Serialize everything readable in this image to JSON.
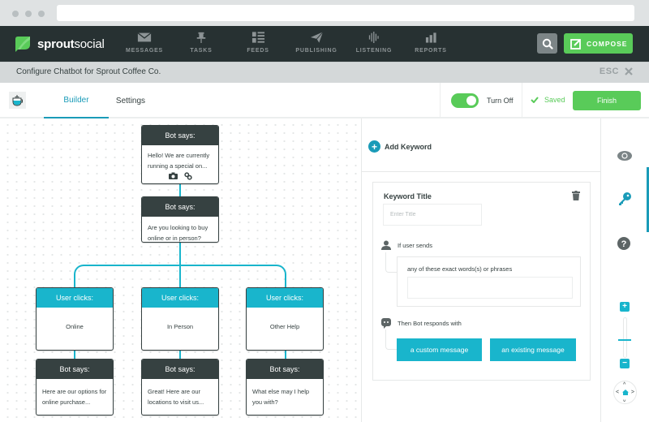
{
  "browser": {
    "address": ""
  },
  "brand": {
    "name_bold": "sprout",
    "name_light": "social"
  },
  "nav": {
    "items": [
      {
        "label": "MESSAGES",
        "icon": "envelope-icon"
      },
      {
        "label": "TASKS",
        "icon": "pushpin-icon"
      },
      {
        "label": "FEEDS",
        "icon": "feed-list-icon"
      },
      {
        "label": "PUBLISHING",
        "icon": "paper-plane-icon"
      },
      {
        "label": "LISTENING",
        "icon": "soundwave-icon"
      },
      {
        "label": "REPORTS",
        "icon": "bar-chart-icon"
      }
    ],
    "search_icon": "search-icon",
    "compose_label": "COMPOSE"
  },
  "subheader": {
    "title": "Configure Chatbot for Sprout Coffee Co.",
    "esc_label": "ESC"
  },
  "toolbar": {
    "tabs": [
      {
        "label": "Builder",
        "active": true
      },
      {
        "label": "Settings",
        "active": false
      }
    ],
    "toggle_on": true,
    "toggle_label": "Turn Off",
    "saved_label": "Saved",
    "finish_label": "Finish"
  },
  "flow": {
    "nodes": [
      {
        "type": "bot",
        "header": "Bot says:",
        "text": "Hello! We are currently running a special on...",
        "attachments": [
          "camera-icon",
          "link-icon"
        ]
      },
      {
        "type": "bot",
        "header": "Bot says:",
        "text": "Are you looking to buy online or in person?"
      },
      {
        "type": "user",
        "header": "User clicks:",
        "text": "Online"
      },
      {
        "type": "user",
        "header": "User clicks:",
        "text": "In Person"
      },
      {
        "type": "user",
        "header": "User clicks:",
        "text": "Other Help"
      },
      {
        "type": "bot",
        "header": "Bot says:",
        "text": "Here are our options for online purchase..."
      },
      {
        "type": "bot",
        "header": "Bot says:",
        "text": "Great! Here are our locations to visit us..."
      },
      {
        "type": "bot",
        "header": "Bot says:",
        "text": "What else may I help you with?"
      }
    ]
  },
  "keyword_panel": {
    "add_label": "Add Keyword",
    "card": {
      "title": "Keyword Title",
      "title_placeholder": "Enter Title",
      "title_value": "",
      "if_label": "If user sends",
      "phrase_label": "any of these exact words(s) or phrases",
      "phrase_value": "",
      "then_label": "Then Bot responds with",
      "buttons": {
        "custom": "a custom message",
        "existing": "an existing message"
      }
    }
  },
  "rail": {
    "icons": [
      "eye-icon",
      "key-icon",
      "help-icon"
    ],
    "active": "key-icon",
    "zoom_in": "+",
    "zoom_out": "−"
  },
  "colors": {
    "nav_bg": "#273132",
    "accent_green": "#59cb59",
    "accent_teal": "#19b5cc",
    "dark_node": "#364141"
  }
}
